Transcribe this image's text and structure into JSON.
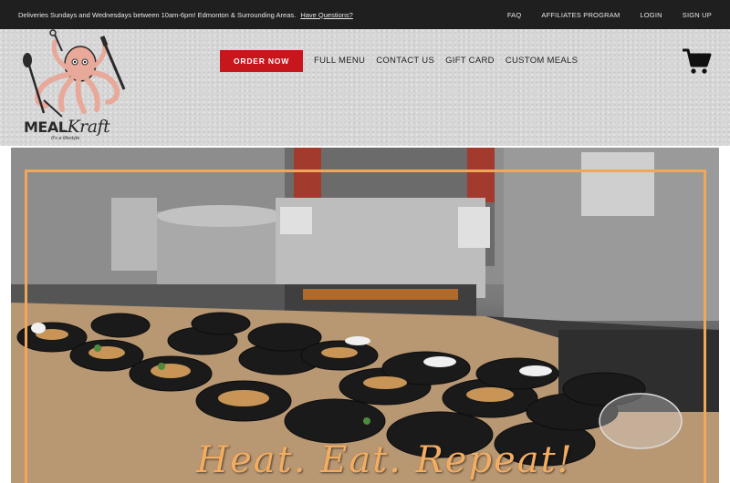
{
  "topbar": {
    "message": "Deliveries Sundays and Wednesdays between 10am-6pm! Edmonton & Surrounding Areas.",
    "question_link": "Have Questions?",
    "links": [
      "FAQ",
      "AFFILIATES PROGRAM",
      "LOGIN",
      "SIGN UP"
    ]
  },
  "header": {
    "logo_text_meal": "MEAL",
    "logo_text_kraft": "Kraft",
    "logo_tagline": "It's a lifestyle",
    "order_button": "ORDER NOW",
    "nav": [
      "FULL MENU",
      "CONTACT US",
      "GIFT CARD",
      "CUSTOM MEALS"
    ],
    "cart_icon": "shopping-cart-icon"
  },
  "hero": {
    "tagline": "Heat. Eat. Repeat!",
    "frame_color": "#f0a75a"
  },
  "colors": {
    "accent": "#c8161d",
    "topbar": "#1f1f1f",
    "header_bg": "#d7d7d7"
  }
}
